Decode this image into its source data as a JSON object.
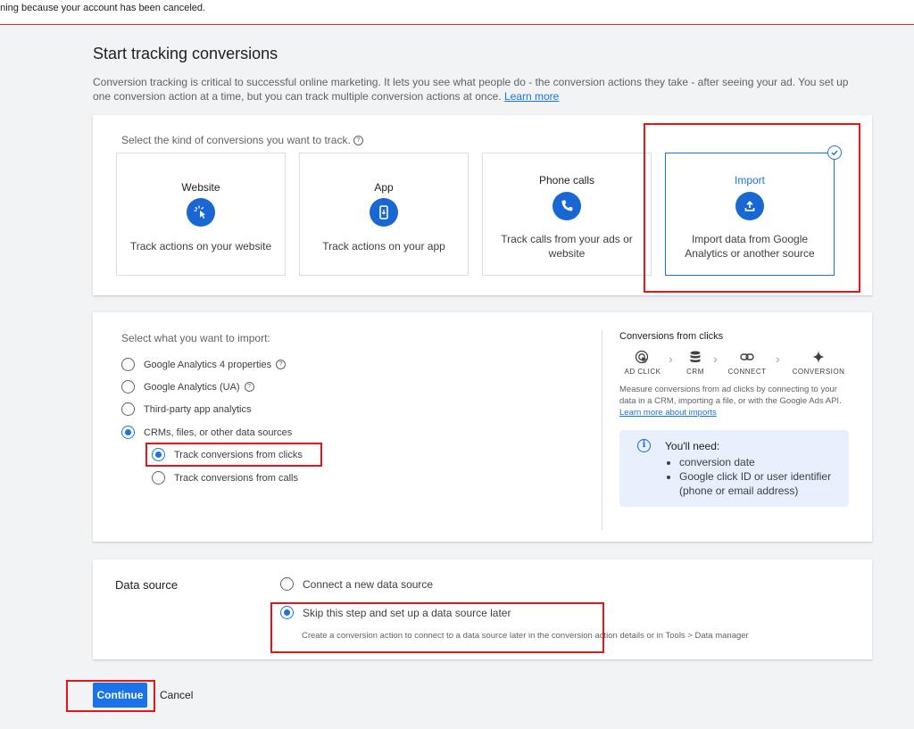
{
  "banner": {
    "text": "nning because your account has been canceled."
  },
  "page": {
    "title": "Start tracking conversions",
    "intro": "Conversion tracking is critical to successful online marketing. It lets you see what people do - the conversion actions they take - after seeing your ad. You set up one conversion action at a time, but you can track multiple conversion actions at once.",
    "learn_more": "Learn more"
  },
  "conversion_types": {
    "prompt": "Select the kind of conversions you want to track.",
    "help_icon": "help-circle-icon",
    "selected": "Import",
    "tiles": [
      {
        "title": "Website",
        "icon": "cursor-click-icon",
        "desc": "Track actions on your website"
      },
      {
        "title": "App",
        "icon": "mobile-app-icon",
        "desc": "Track actions on your app"
      },
      {
        "title": "Phone calls",
        "icon": "phone-icon",
        "desc": "Track calls from your ads or website"
      },
      {
        "title": "Import",
        "icon": "upload-icon",
        "desc": "Import data from Google Analytics or another source"
      }
    ]
  },
  "import_section": {
    "prompt": "Select what you want to import:",
    "options": [
      {
        "label": "Google Analytics 4 properties",
        "has_help": true,
        "selected": false
      },
      {
        "label": "Google Analytics (UA)",
        "has_help": true,
        "selected": false
      },
      {
        "label": "Third-party app analytics",
        "has_help": false,
        "selected": false
      },
      {
        "label": "CRMs, files, or other data sources",
        "has_help": false,
        "selected": true
      }
    ],
    "sub_options": [
      {
        "label": "Track conversions from clicks",
        "selected": true
      },
      {
        "label": "Track conversions from calls",
        "selected": false
      }
    ]
  },
  "flow": {
    "title": "Conversions from clicks",
    "steps": [
      {
        "label": "AD CLICK",
        "icon": "ad-click-icon"
      },
      {
        "label": "CRM",
        "icon": "database-icon"
      },
      {
        "label": "CONNECT",
        "icon": "link-icon"
      },
      {
        "label": "CONVERSION",
        "icon": "sparkle-icon"
      }
    ],
    "arrow_icon": "chevron-right-icon",
    "desc": "Measure conversions from ad clicks by connecting to your data in a CRM, importing a file, or with the Google Ads API.",
    "desc_link": "Learn more about imports",
    "need_title": "You'll need:",
    "need_items": [
      "conversion date",
      "Google click ID or user identifier (phone or email address)"
    ],
    "info_icon": "info-icon"
  },
  "data_source": {
    "label": "Data source",
    "options": [
      {
        "label": "Connect a new data source",
        "selected": false
      },
      {
        "label": "Skip this step and set up a data source later",
        "selected": true
      }
    ],
    "sub_text": "Create a conversion action to connect to a data source later in the conversion action details or in Tools > Data manager"
  },
  "actions": {
    "continue": "Continue",
    "cancel": "Cancel"
  },
  "colors": {
    "accent": "#1a73e8",
    "icon_bg": "#1967d2",
    "highlight": "#e4151b",
    "info_bg": "#e8f0fe"
  }
}
